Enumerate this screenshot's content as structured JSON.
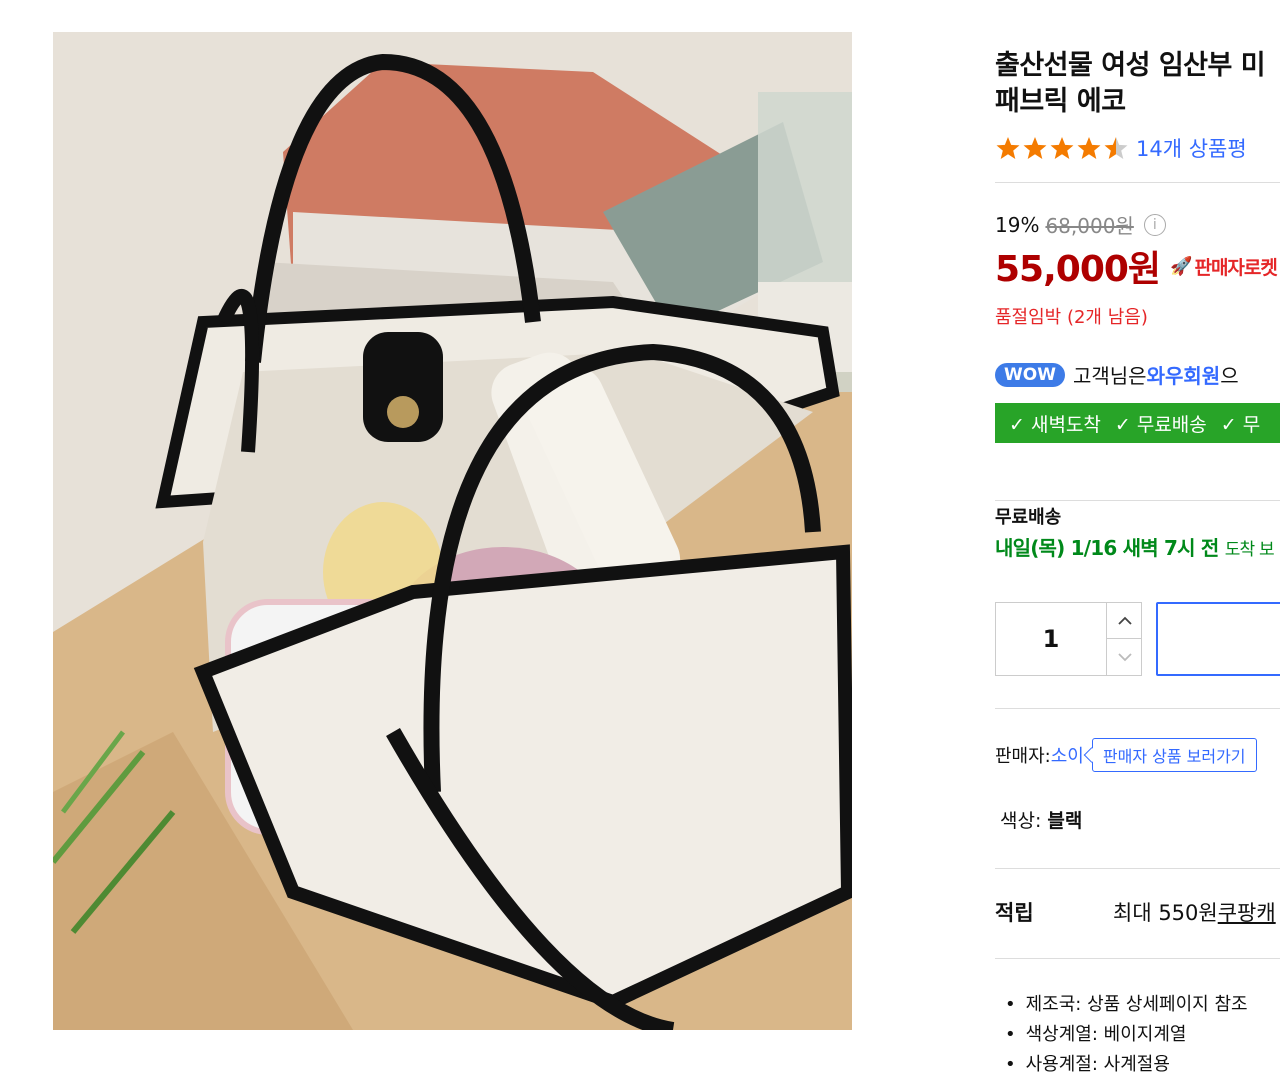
{
  "product": {
    "title_line1": "출산선물 여성 임산부 미",
    "title_line2": "패브릭 에코",
    "rating_stars": 4.5,
    "review_count": "14개 상품평"
  },
  "price": {
    "discount": "19%",
    "original": "68,000원",
    "sale": "55,000원",
    "badge": "판매자로켓",
    "stock_notice": "품절임박 (2개 남음)"
  },
  "wow": {
    "badge": "WOW",
    "text_prefix": "고객님은 ",
    "link": "와우회원",
    "text_suffix": "으"
  },
  "benefits": [
    "✓ 새벽도착",
    "✓ 무료배송",
    "✓ 무"
  ],
  "shipping": {
    "label": "무료배송",
    "date": "내일(목) 1/16 새벽 7시 전",
    "suffix": "도착 보"
  },
  "quantity": {
    "value": "1",
    "up": "^",
    "down": "v"
  },
  "seller": {
    "label": "판매자: ",
    "name": "소이",
    "button": "판매자 상품 보러가기"
  },
  "color": {
    "label": "색상: ",
    "value": "블랙"
  },
  "reward": {
    "label": "적립",
    "text": "최대 550원 ",
    "link": "쿠팡캐"
  },
  "specs": [
    "제조국: 상품 상세페이지 참조",
    "색상계열: 베이지계열",
    "사용계절: 사계절용"
  ],
  "colors": {
    "price_red": "#ae0000",
    "link_blue": "#346aff",
    "benefit_green": "#28a428",
    "star_orange": "#f47b00"
  }
}
